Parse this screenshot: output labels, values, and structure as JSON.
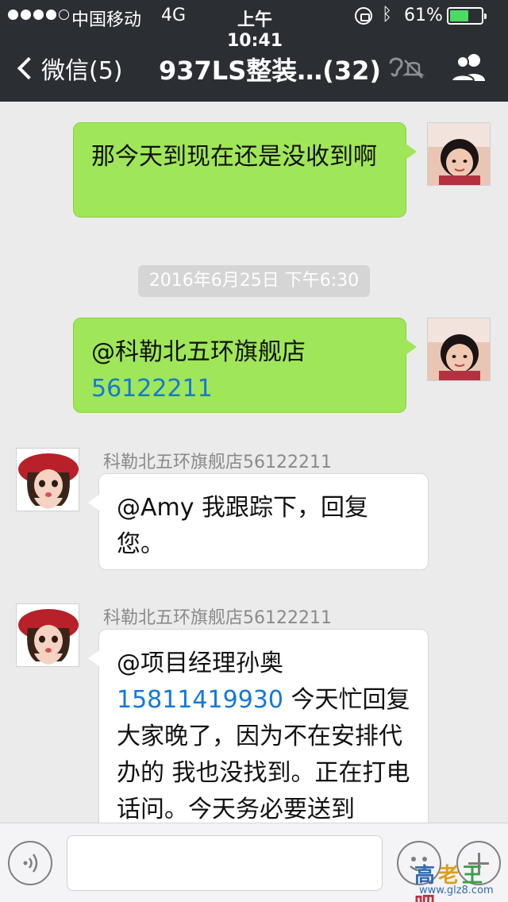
{
  "status_bar": {
    "carrier": "中国移动",
    "network": "4G",
    "time": "上午10:41",
    "battery_percent": "61%",
    "battery_level": 0.61,
    "signal_bars": 4,
    "icons": [
      "signal-dots-icon",
      "lock-rotation-icon",
      "bluetooth-icon",
      "battery-icon"
    ]
  },
  "nav": {
    "back_label": "微信(5)",
    "title": "937LS整装…(32)",
    "icons": [
      "back-chevron-icon",
      "earpiece-icon",
      "mute-bell-icon",
      "group-members-icon"
    ]
  },
  "messages": [
    {
      "type": "outgoing",
      "text": "那今天到现在还是没收到啊"
    },
    {
      "type": "timestamp",
      "text": "2016年6月25日 下午6:30"
    },
    {
      "type": "outgoing",
      "text_prefix": "@科勒北五环旗舰店",
      "link": "56122211"
    },
    {
      "type": "incoming",
      "sender": "科勒北五环旗舰店56122211",
      "text": "@Amy 我跟踪下，回复您。"
    },
    {
      "type": "incoming",
      "sender": "科勒北五环旗舰店56122211",
      "text_prefix": "@项目经理孙奥",
      "link": "15811419930",
      "text_suffix": "今天忙回复大家晚了，因为不在安排代办的 我也没找到。正在打电话问。今天务必要送到"
    }
  ],
  "input_bar": {
    "placeholder": "",
    "icons": [
      "voice-icon",
      "emoji-icon",
      "plus-icon"
    ]
  },
  "watermark": {
    "chars": "高老王吧",
    "url": "www.glz8.com"
  },
  "colors": {
    "nav_bg": "#2b2f34",
    "chat_bg": "#ebebeb",
    "outgoing_bubble": "#9fe658",
    "incoming_bubble": "#ffffff",
    "link": "#1578d8"
  }
}
